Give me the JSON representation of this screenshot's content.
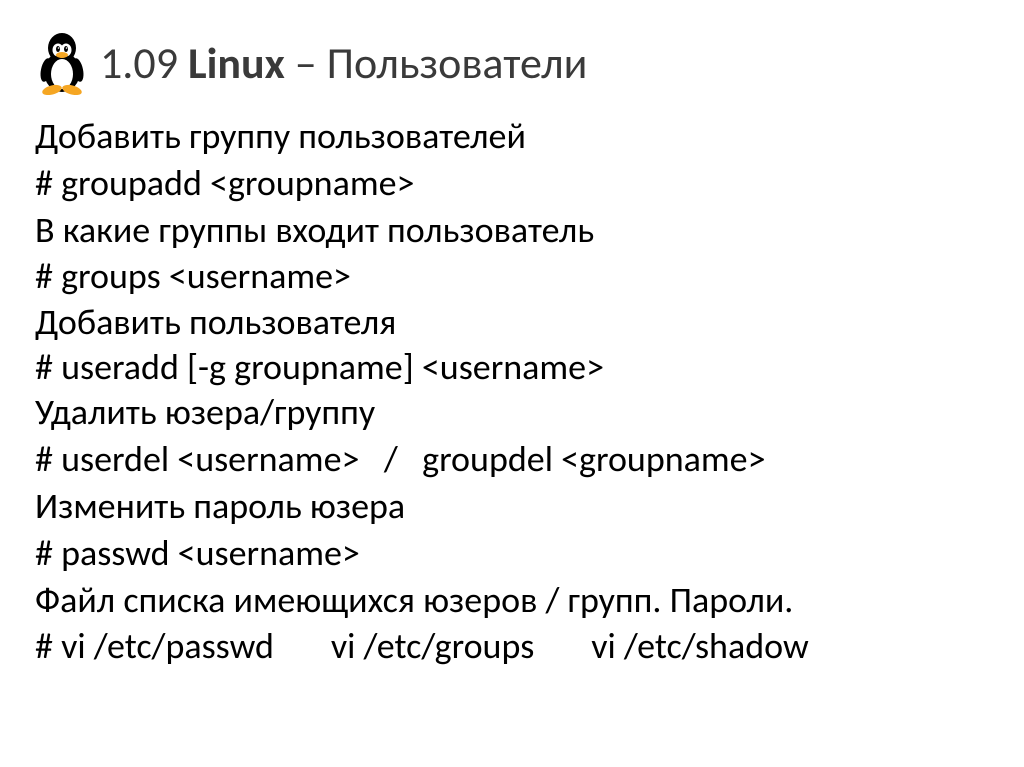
{
  "header": {
    "number": "1.09",
    "word_bold": "Linux",
    "dash": " – ",
    "subtitle": "Пользователи"
  },
  "lines": [
    "Добавить группу пользователей",
    "# groupadd <groupname>",
    "В какие группы входит пользователь",
    "# groups <username>",
    "Добавить пользователя",
    "# useradd [-g groupname] <username>",
    "Удалить юзера/группу",
    "# userdel <username>   /   groupdel <groupname>",
    "Изменить пароль юзера",
    "# passwd <username>",
    "Файл списка имеющихся юзеров / групп. Пароли.",
    "# vi /etc/passwd       vi /etc/groups       vi /etc/shadow"
  ]
}
